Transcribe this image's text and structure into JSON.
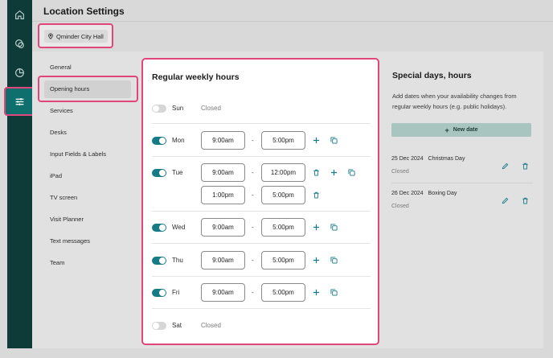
{
  "header": {
    "title": "Location Settings"
  },
  "location": {
    "name": "Qminder City Hall"
  },
  "rail": {
    "icons": [
      "home-icon",
      "chat-icon",
      "chart-icon",
      "settings-sliders-icon"
    ],
    "active_index": 3
  },
  "subnav": {
    "items": [
      "General",
      "Opening hours",
      "Services",
      "Desks",
      "Input Fields & Labels",
      "iPad",
      "TV screen",
      "Visit Planner",
      "Text messages",
      "Team"
    ],
    "active": "Opening hours"
  },
  "weekly": {
    "title": "Regular weekly hours",
    "closed_label": "Closed",
    "days": [
      {
        "label": "Sun",
        "enabled": false,
        "ranges": []
      },
      {
        "label": "Mon",
        "enabled": true,
        "ranges": [
          {
            "from": "9:00am",
            "to": "5:00pm"
          }
        ]
      },
      {
        "label": "Tue",
        "enabled": true,
        "ranges": [
          {
            "from": "9:00am",
            "to": "12:00pm"
          },
          {
            "from": "1:00pm",
            "to": "5:00pm"
          }
        ]
      },
      {
        "label": "Wed",
        "enabled": true,
        "ranges": [
          {
            "from": "9:00am",
            "to": "5:00pm"
          }
        ]
      },
      {
        "label": "Thu",
        "enabled": true,
        "ranges": [
          {
            "from": "9:00am",
            "to": "5:00pm"
          }
        ]
      },
      {
        "label": "Fri",
        "enabled": true,
        "ranges": [
          {
            "from": "9:00am",
            "to": "5:00pm"
          }
        ]
      },
      {
        "label": "Sat",
        "enabled": false,
        "ranges": []
      }
    ]
  },
  "special": {
    "title": "Special days, hours",
    "description": "Add dates when your availability changes from regular weekly hours (e.g. public holidays).",
    "new_date_label": "New date",
    "entries": [
      {
        "date": "25 Dec 2024",
        "name": "Christmas Day",
        "status": "Closed"
      },
      {
        "date": "26 Dec 2024",
        "name": "Boxing Day",
        "status": "Closed"
      }
    ]
  },
  "colors": {
    "accent": "#157b86",
    "highlight": "#e0457b",
    "rail": "#0e3b38",
    "button": "#a8c6bf"
  }
}
